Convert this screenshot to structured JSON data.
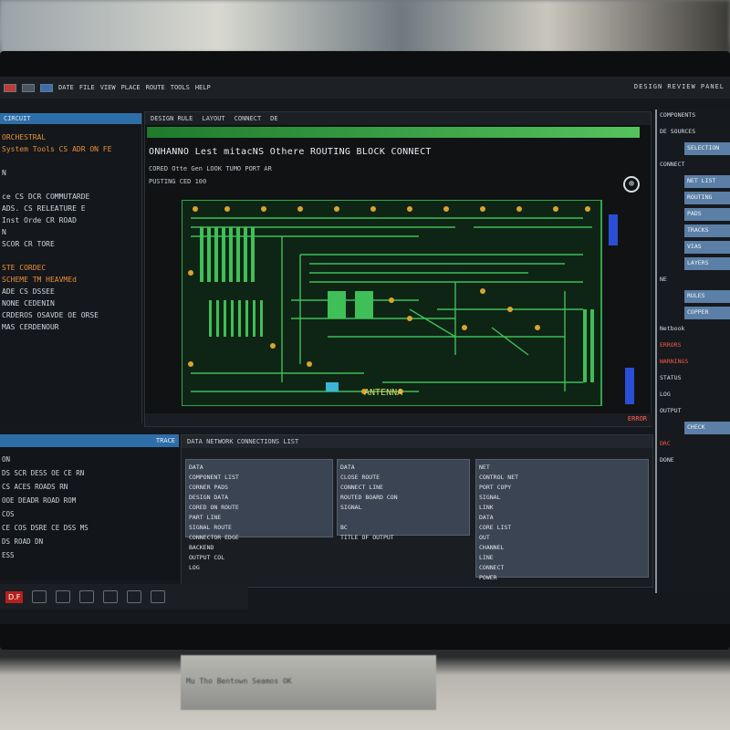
{
  "menubar": {
    "items": [
      "DATE",
      "FILE",
      "VIEW",
      "PLACE",
      "ROUTE",
      "TOOLS",
      "HELP"
    ],
    "right_label": "DESIGN REVIEW PANEL"
  },
  "left_pane": {
    "header": "CIRCUIT",
    "lines": [
      {
        "text": "ORCHESTRAL",
        "orange": true
      },
      {
        "text": "System  Tools   CS ADR ON FE",
        "orange": true
      },
      {
        "text": "",
        "orange": false
      },
      {
        "text": "N",
        "orange": false
      },
      {
        "text": "",
        "orange": false
      },
      {
        "text": "ce CS DCR COMMUTARDE",
        "orange": false
      },
      {
        "text": "ADS. CS RELEATURE   E",
        "orange": false
      },
      {
        "text": "Inst Orde  CR ROAD",
        "orange": false
      },
      {
        "text": "N",
        "orange": false
      },
      {
        "text": "SCOR  CR  TORE",
        "orange": false
      },
      {
        "text": "",
        "orange": false
      },
      {
        "text": "STE CORDEC",
        "orange": true
      },
      {
        "text": "SCHEME TM HEAVMEd",
        "orange": true
      },
      {
        "text": "ADE CS DSSEE",
        "orange": false
      },
      {
        "text": "NONE CEDENIN",
        "orange": false
      },
      {
        "text": "CRDEROS OSAVDE  OE ORSE",
        "orange": false
      },
      {
        "text": "MAS CERDENOUR",
        "orange": false
      }
    ]
  },
  "main_view": {
    "tabs": [
      "DESIGN RULE",
      "LAYOUT",
      "CONNECT",
      "DE"
    ],
    "title": "ONHANNO Lest mitacNS Othere  ROUTING BLOCK CONNECT",
    "subtitle": "CORED Otte Gen LOOK  TUMO  PORT AR",
    "subtitle2": "PUSTING CED  100",
    "zoom_icon": "zoom-icon",
    "status": "ERROR",
    "pcb_label": "ANTENNA"
  },
  "right_pane": {
    "rows": [
      {
        "text": "COMPONENTS",
        "style": "plain"
      },
      {
        "text": "DE SOURCES",
        "style": "plain"
      },
      {
        "text": "SELECTION",
        "style": "blue"
      },
      {
        "text": "CONNECT",
        "style": "plain"
      },
      {
        "text": "NET LIST",
        "style": "blue"
      },
      {
        "text": "ROUTING",
        "style": "blue"
      },
      {
        "text": "PADS",
        "style": "blue"
      },
      {
        "text": "TRACKS",
        "style": "blue"
      },
      {
        "text": "VIAS",
        "style": "blue"
      },
      {
        "text": "LAYERS",
        "style": "blue"
      },
      {
        "text": "NE",
        "style": "plain"
      },
      {
        "text": "RULES",
        "style": "blue"
      },
      {
        "text": "COPPER",
        "style": "blue"
      },
      {
        "text": "Netbook",
        "style": "plain"
      },
      {
        "text": "ERRORS",
        "style": "red"
      },
      {
        "text": "WARNINGS",
        "style": "red"
      },
      {
        "text": "STATUS",
        "style": "plain"
      },
      {
        "text": "LOG",
        "style": "plain"
      },
      {
        "text": "OUTPUT",
        "style": "plain"
      },
      {
        "text": "CHECK",
        "style": "blue"
      },
      {
        "text": "DRC",
        "style": "red"
      },
      {
        "text": "DONE",
        "style": "plain"
      }
    ]
  },
  "bottom_left": {
    "header": "TRACE",
    "lines": [
      "ON",
      "DS SCR DESS OE CE RN",
      "CS ACES ROADS RN",
      "OOE DEADR ROAD ROM",
      "COS",
      "CE COS DSRE CE DSS MS",
      "DS ROAD DN",
      "ESS"
    ]
  },
  "tables": {
    "header": "DATA  NETWORK  CONNECTIONS  LIST",
    "t1": [
      "DATA",
      "COMPONENT LIST",
      "CORNER PADS",
      "DESIGN DATA",
      "CORED ON ROUTE",
      "PART LINE",
      "SIGNAL ROUTE",
      "CONNECTOR EDGE",
      "BACKEND",
      "OUTPUT COL",
      "LOG"
    ],
    "t2": [
      "DATA",
      "CLOSE ROUTE",
      "CONNECT LINE",
      "ROUTED BOARD CON",
      "SIGNAL",
      "",
      "BC",
      "TITLE OF OUTPUT"
    ],
    "t3": [
      "NET",
      "CONTROL NET",
      "PORT COPY",
      "SIGNAL",
      "LINK",
      "DATA",
      "CORE LIST",
      "OUT",
      "CHANNEL",
      "LINE",
      "CONNECT",
      "POWER"
    ]
  },
  "bottom_toolbar": {
    "badge": "D.F"
  },
  "stand_label": "Mu  Tho  Bentown  Seamos  OK"
}
